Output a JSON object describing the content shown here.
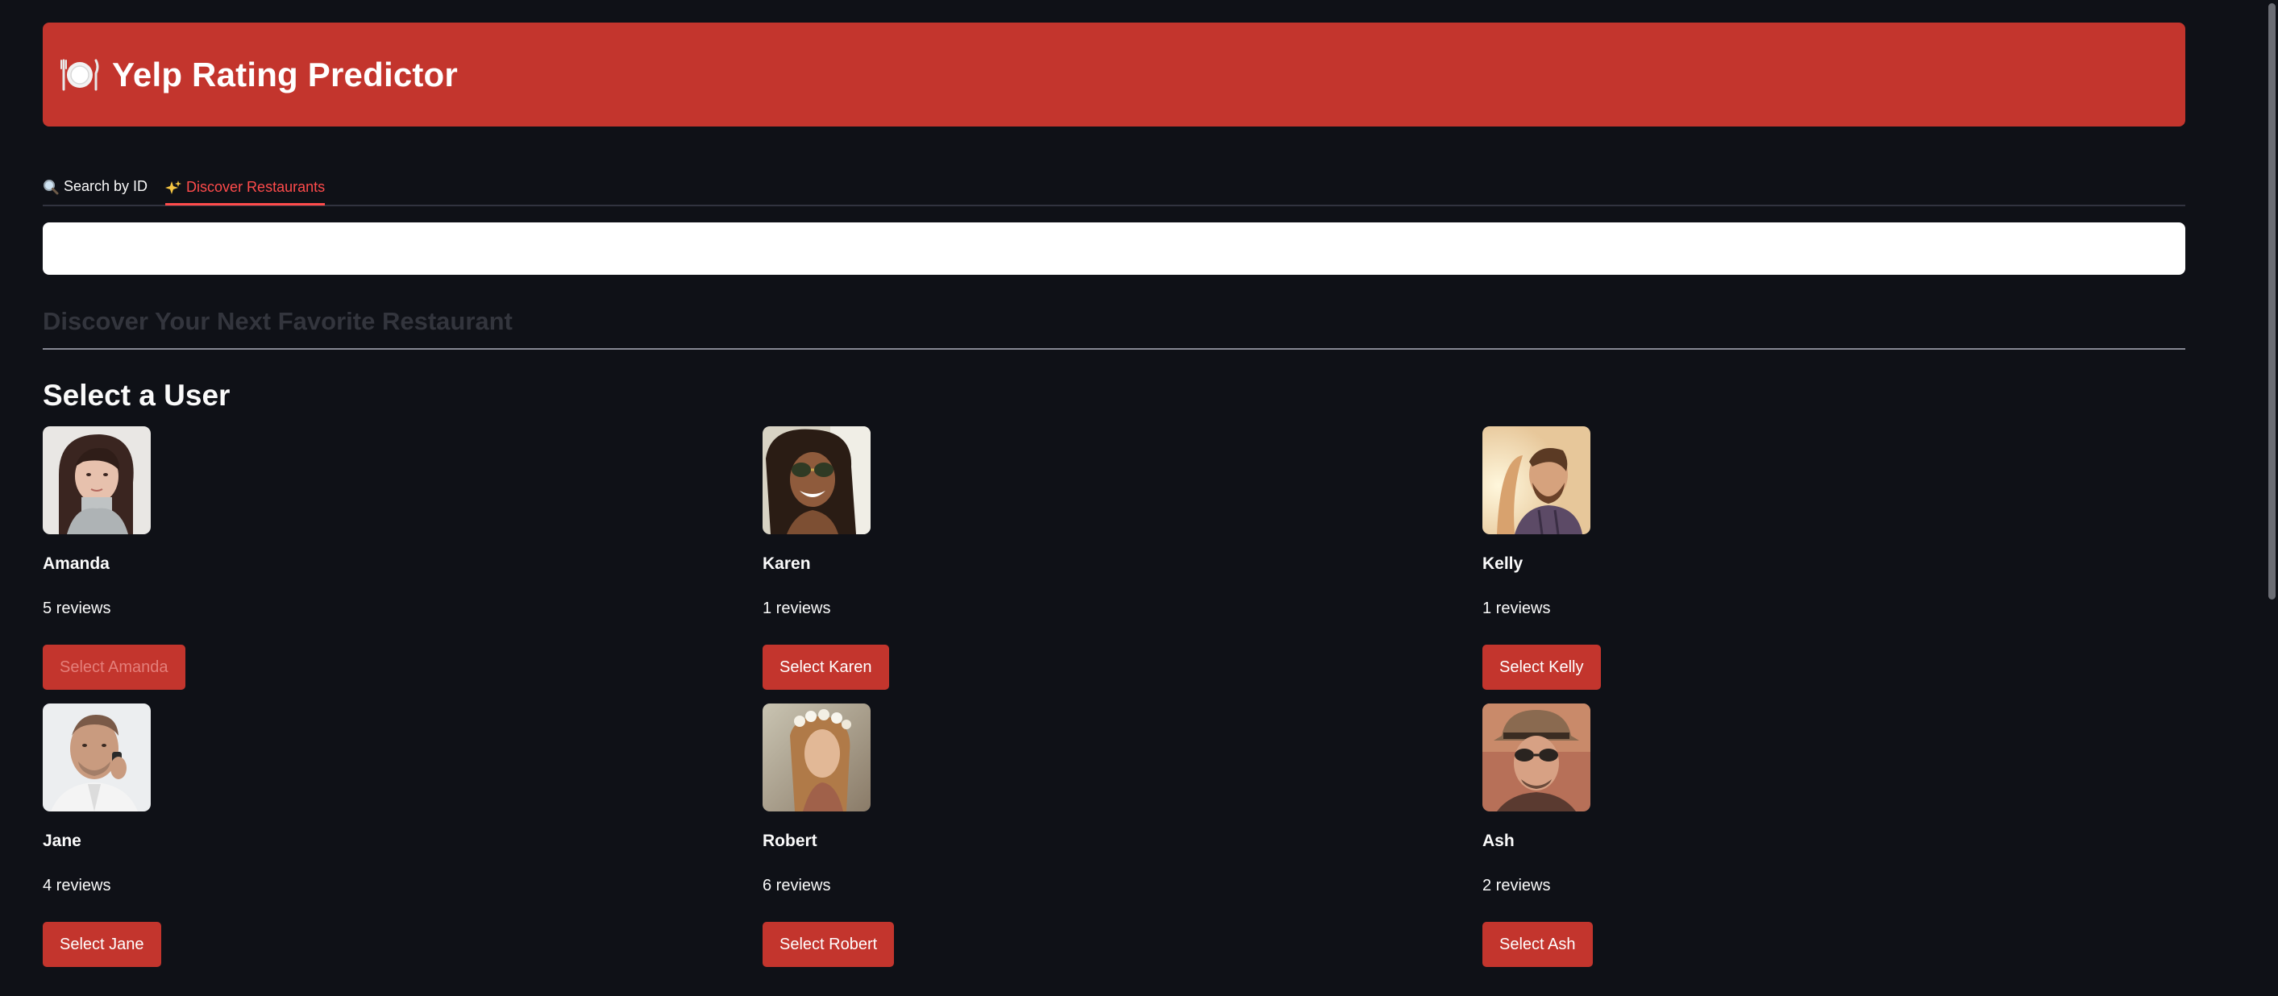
{
  "app": {
    "title": "Yelp Rating Predictor",
    "brand_color": "#c3352d",
    "icon": "plate-cutlery-icon"
  },
  "tabs": [
    {
      "label": "Search by ID",
      "icon": "magnifier-icon",
      "active": false
    },
    {
      "label": "Discover Restaurants",
      "icon": "sparkles-icon",
      "active": true
    }
  ],
  "search": {
    "value": "",
    "placeholder": ""
  },
  "discover": {
    "title": "Discover Your Next Favorite Restaurant"
  },
  "select_user": {
    "heading": "Select a User"
  },
  "users": [
    {
      "name": "Amanda",
      "reviews": "5 reviews",
      "button": "Select Amanda",
      "disabled": true
    },
    {
      "name": "Karen",
      "reviews": "1 reviews",
      "button": "Select Karen",
      "disabled": false
    },
    {
      "name": "Kelly",
      "reviews": "1 reviews",
      "button": "Select Kelly",
      "disabled": false
    },
    {
      "name": "Jane",
      "reviews": "4 reviews",
      "button": "Select Jane",
      "disabled": false
    },
    {
      "name": "Robert",
      "reviews": "6 reviews",
      "button": "Select Robert",
      "disabled": false
    },
    {
      "name": "Ash",
      "reviews": "2 reviews",
      "button": "Select Ash",
      "disabled": false
    }
  ]
}
